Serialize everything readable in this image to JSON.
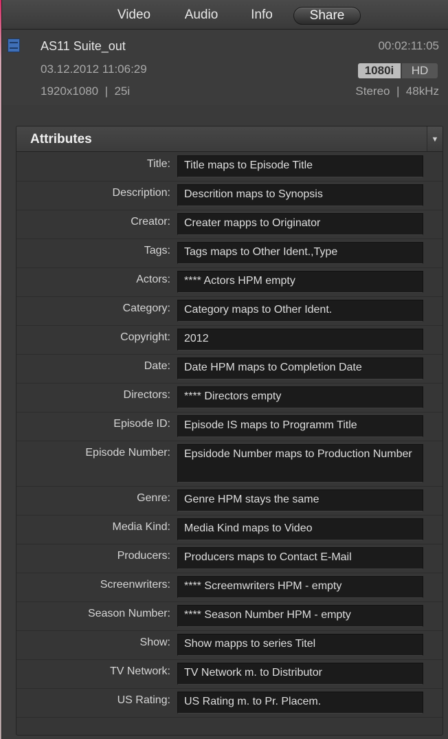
{
  "tabs": [
    {
      "label": "Video"
    },
    {
      "label": "Audio"
    },
    {
      "label": "Info"
    },
    {
      "label": "Share",
      "active": true
    }
  ],
  "clip": {
    "name": "AS11 Suite_out",
    "duration": "00:02:11:05",
    "date": "03.12.2012 11:06:29",
    "format_badge": "1080i",
    "hd_badge": "HD",
    "resolution": "1920x1080  |  25i",
    "audio": "Stereo  |  48kHz",
    "icon": "film-clip-icon"
  },
  "attributes": {
    "title": "Attributes",
    "collapse_icon": "dropdown-arrow-icon",
    "rows": [
      {
        "label": "Title:",
        "value": "Title maps to Episode Title"
      },
      {
        "label": "Description:",
        "value": "Descrition maps to Synopsis"
      },
      {
        "label": "Creator:",
        "value": "Creater mapps to Originator"
      },
      {
        "label": "Tags:",
        "value": "Tags maps to Other Ident.,Type"
      },
      {
        "label": "Actors:",
        "value": "**** Actors HPM empty"
      },
      {
        "label": "Category:",
        "value": "Category maps to Other Ident."
      },
      {
        "label": "Copyright:",
        "value": "2012"
      },
      {
        "label": "Date:",
        "value": "Date HPM maps to Completion Date"
      },
      {
        "label": "Directors:",
        "value": "**** Directors empty"
      },
      {
        "label": "Episode ID:",
        "value": "Episode IS maps to Programm Title"
      },
      {
        "label": "Episode Number:",
        "value": "Epsidode Number maps to Production Number"
      },
      {
        "label": "Genre:",
        "value": "Genre HPM stays the same"
      },
      {
        "label": "Media Kind:",
        "value": "Media Kind maps to Video"
      },
      {
        "label": "Producers:",
        "value": "Producers maps to Contact E-Mail"
      },
      {
        "label": "Screenwriters:",
        "value": "**** Screemwriters HPM - empty"
      },
      {
        "label": "Season Number:",
        "value": "**** Season Number HPM - empty"
      },
      {
        "label": "Show:",
        "value": "Show mapps to series Titel"
      },
      {
        "label": "TV Network:",
        "value": "TV Network m. to Distributor"
      },
      {
        "label": "US Rating:",
        "value": "US Rating m. to Pr. Placem."
      }
    ]
  },
  "colors": {
    "window_bg": "#3a3a3a",
    "panel_bg": "#363636",
    "field_bg": "#1b1b1b",
    "text_primary": "#e6e6e6",
    "text_secondary": "#a9a9a9",
    "icon_blue": "#3f6fb7"
  }
}
